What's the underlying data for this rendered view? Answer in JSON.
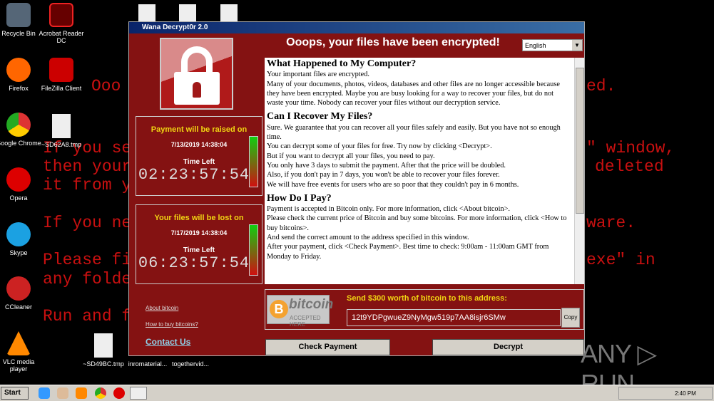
{
  "desktop": {
    "background_lines": [
      "Ooo",
      "ed.",
      "If you se",
      "\" window,",
      "then your",
      "deleted",
      "it from y",
      "If you ne",
      "ware.",
      "Please fi",
      "exe\" in",
      "any folde",
      "Run and f"
    ],
    "icons": [
      {
        "label": "Recycle Bin"
      },
      {
        "label": "Acrobat Reader DC"
      },
      {
        "label": "Firefox"
      },
      {
        "label": "FileZilla Client"
      },
      {
        "label": "Google Chrome"
      },
      {
        "label": "~SD62A8.tmp"
      },
      {
        "label": "Opera"
      },
      {
        "label": "Skype"
      },
      {
        "label": "CCleaner"
      },
      {
        "label": "VLC media player"
      },
      {
        "label": "~SD49BC.tmp"
      },
      {
        "label": "inromaterial..."
      },
      {
        "label": "togethervid..."
      }
    ]
  },
  "window": {
    "title": "Wana Decrypt0r 2.0",
    "header": "Ooops, your files have been encrypted!",
    "language": "English",
    "box1": {
      "heading": "Payment will be raised on",
      "date": "7/13/2019 14:38:04",
      "time_left_label": "Time Left",
      "countdown": "02:23:57:54",
      "level": 0.85
    },
    "box2": {
      "heading": "Your files will be lost on",
      "date": "7/17/2019 14:38:04",
      "time_left_label": "Time Left",
      "countdown": "06:23:57:54",
      "level": 0.95
    },
    "links": {
      "about": "About bitcoin",
      "how": "How to buy bitcoins?",
      "contact": "Contact Us"
    },
    "sections": [
      {
        "title": "What Happened to My Computer?",
        "paras": [
          "Your important files are encrypted.",
          "Many of your documents, photos, videos, databases and other files are no longer accessible because they have been encrypted. Maybe you are busy looking for a way to recover your files, but do not waste your time. Nobody can recover your files without our decryption service."
        ]
      },
      {
        "title": "Can I Recover My Files?",
        "paras": [
          "Sure. We guarantee that you can recover all your files safely and easily. But you have not so enough time.",
          "You can decrypt some of your files for free. Try now by clicking <Decrypt>.",
          "But if you want to decrypt all your files, you need to pay.",
          "You only have 3 days to submit the payment. After that the price will be doubled.",
          "Also, if you don't pay in 7 days, you won't be able to recover your files forever.",
          "We will have free events for users who are so poor that they couldn't pay in 6 months."
        ]
      },
      {
        "title": "How Do I Pay?",
        "paras": [
          "Payment is accepted in Bitcoin only. For more information, click <About bitcoin>.",
          "Please check the current price of Bitcoin and buy some bitcoins. For more information, click <How to buy bitcoins>.",
          "And send the correct amount to the address specified in this window.",
          "After your payment, click <Check Payment>. Best time to check: 9:00am - 11:00am GMT from Monday to Friday."
        ]
      }
    ],
    "bitcoin": {
      "logo_word": "bitcoin",
      "logo_sub": "ACCEPTED HERE",
      "send": "Send $300 worth of bitcoin to this address:",
      "address": "12t9YDPgwueZ9NyMgw519p7AA8isjr6SMw",
      "copy": "Copy"
    },
    "buttons": {
      "check": "Check Payment",
      "decrypt": "Decrypt"
    }
  },
  "taskbar": {
    "start": "Start",
    "clock": "2:40 PM"
  },
  "watermark": "ANY ▷ RUN"
}
